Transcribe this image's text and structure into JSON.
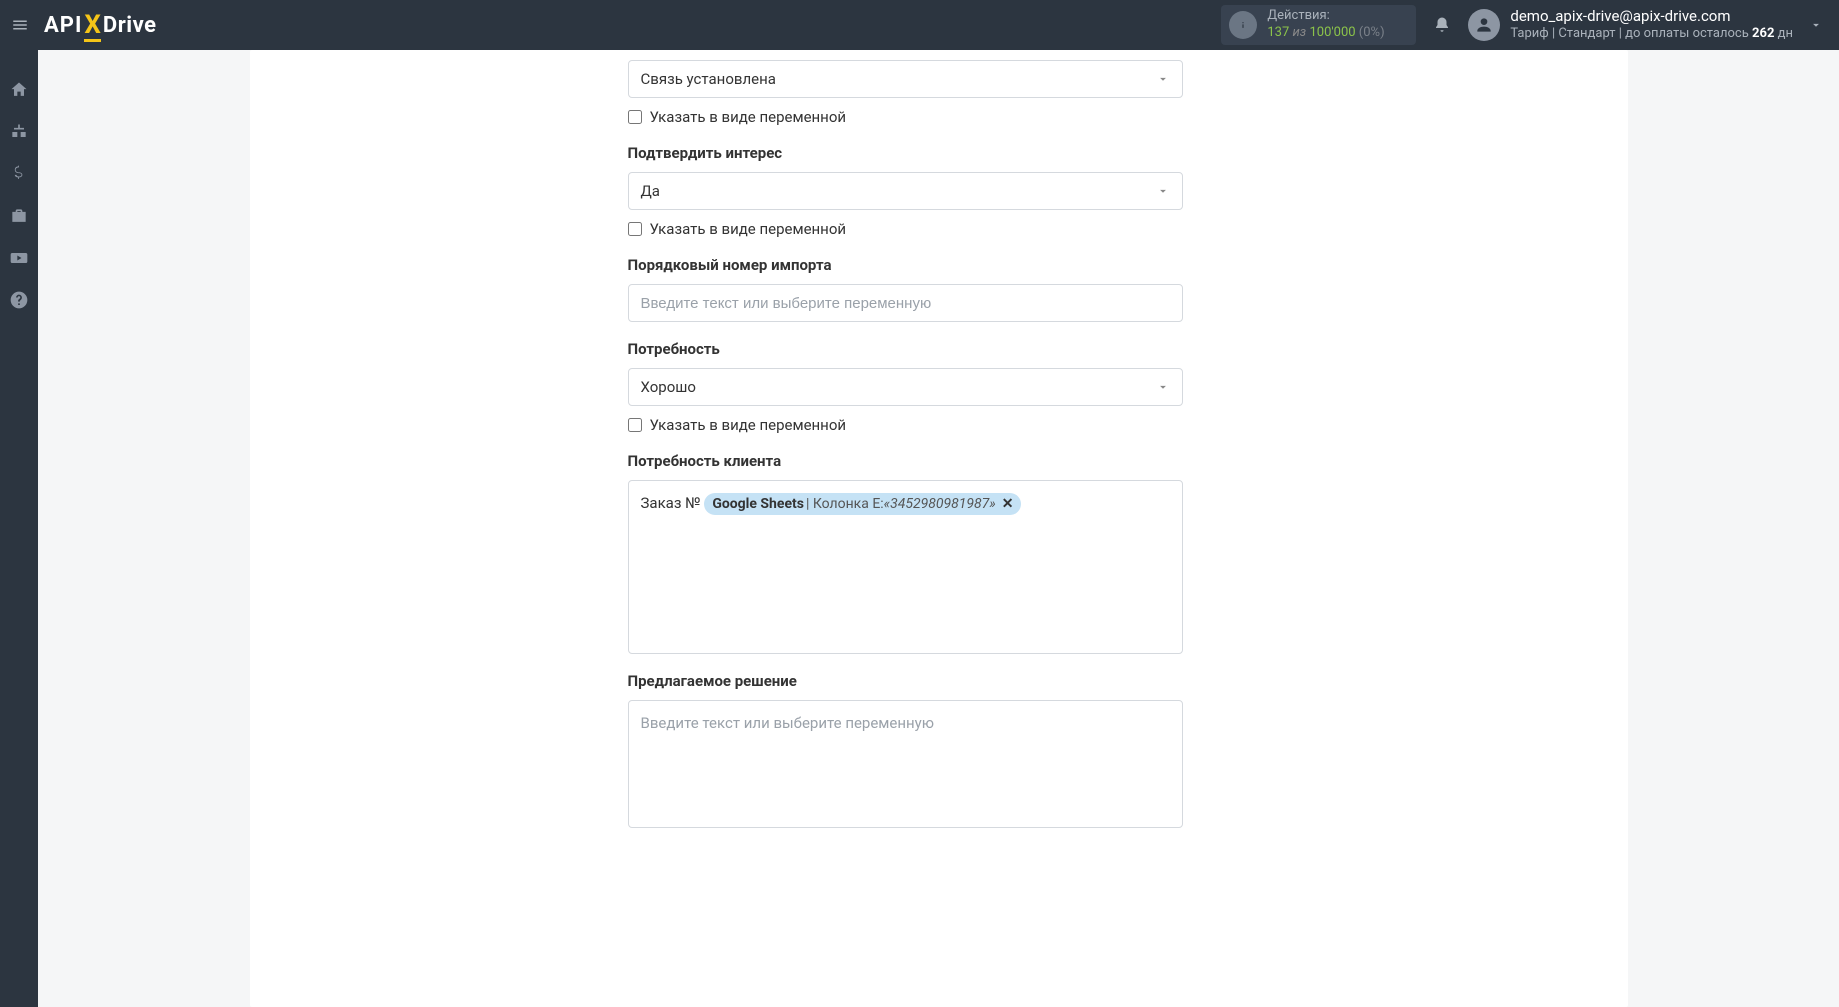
{
  "header": {
    "logo": {
      "part1": "API",
      "part2": "X",
      "part3": "Drive"
    },
    "actions": {
      "label": "Действия:",
      "count": "137",
      "sep": "из",
      "limit": "100'000",
      "pct": "(0%)"
    },
    "email": "demo_apix-drive@apix-drive.com",
    "tariff_prefix": "Тариф | Стандарт | до оплаты осталось ",
    "tariff_days": "262",
    "tariff_suffix": " дн"
  },
  "form": {
    "f1": {
      "value": "Связь установлена",
      "checkbox_label": "Указать в виде переменной"
    },
    "f2": {
      "label": "Подтвердить интерес",
      "value": "Да",
      "checkbox_label": "Указать в виде переменной"
    },
    "f3": {
      "label": "Порядковый номер импорта",
      "placeholder": "Введите текст или выберите переменную"
    },
    "f4": {
      "label": "Потребность",
      "value": "Хорошо",
      "checkbox_label": "Указать в виде переменной"
    },
    "f5": {
      "label": "Потребность клиента",
      "prefix": "Заказ № ",
      "tag_source": "Google Sheets",
      "tag_mid": " | Колонка E: ",
      "tag_value": "«3452980981987»",
      "tag_close": "✕"
    },
    "f6": {
      "label": "Предлагаемое решение",
      "placeholder": "Введите текст или выберите переменную"
    }
  }
}
